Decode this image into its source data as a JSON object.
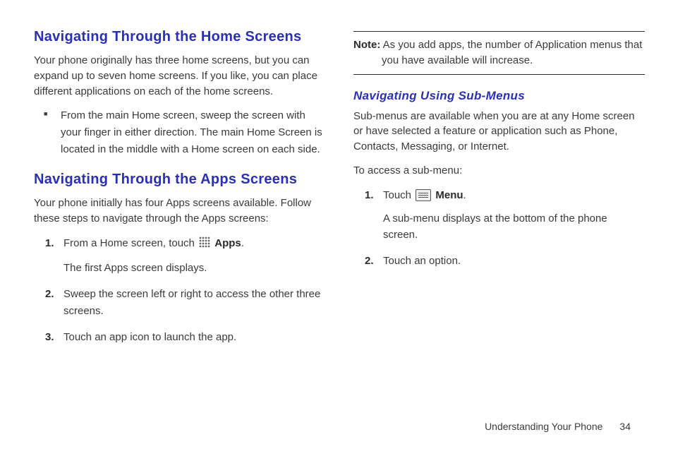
{
  "left": {
    "section1": {
      "heading": "Navigating Through the Home Screens",
      "para": "Your phone originally has three home screens, but you can expand up to seven home screens. If you like, you can place different applications on each of the home screens.",
      "bullet": "From the main Home screen, sweep the screen with your finger in either direction. The main Home Screen is located in the middle with a Home screen on each side."
    },
    "section2": {
      "heading": "Navigating Through the Apps Screens",
      "para": "Your phone initially has four Apps screens available. Follow these steps to navigate through the Apps screens:",
      "steps": {
        "s1_num": "1.",
        "s1_a": "From a Home screen, touch ",
        "s1_b": "Apps",
        "s1_c": ".",
        "s1_sub": "The first Apps screen displays.",
        "s2_num": "2.",
        "s2": "Sweep the screen left or right to access the other three screens.",
        "s3_num": "3.",
        "s3": "Touch an app icon to launch the app."
      }
    }
  },
  "right": {
    "note_label": "Note:",
    "note_text": " As you add apps, the number of Application menus that you have available will increase.",
    "section3": {
      "heading": "Navigating Using Sub-Menus",
      "para1": "Sub-menus are available when you are at any Home screen or have selected a feature or application such as Phone, Contacts, Messaging, or Internet.",
      "para2": "To access a sub-menu:",
      "steps": {
        "s1_num": "1.",
        "s1_a": "Touch ",
        "s1_b": "Menu",
        "s1_c": ".",
        "s1_sub": "A sub-menu displays at the bottom of the phone screen.",
        "s2_num": "2.",
        "s2": "Touch an option."
      }
    }
  },
  "footer": {
    "section": "Understanding Your Phone",
    "page": "34"
  }
}
